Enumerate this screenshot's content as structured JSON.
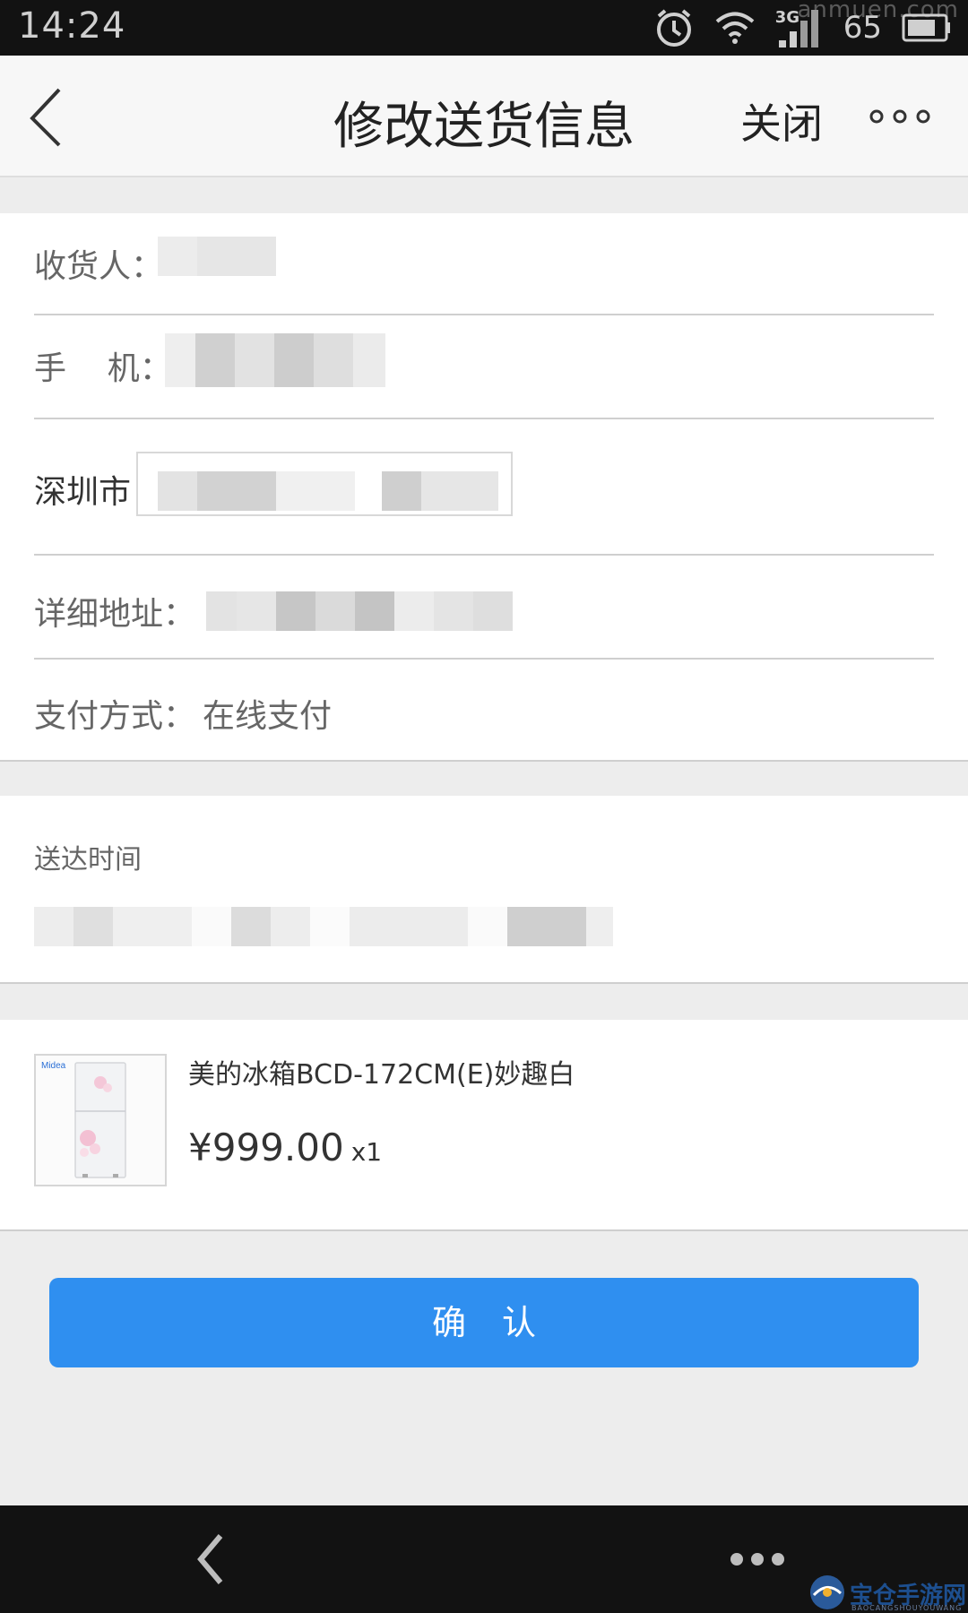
{
  "status_bar": {
    "time": "14:24",
    "network": "3G",
    "battery": "65",
    "watermark": "anmuen.com",
    "icons": [
      "alarm-icon",
      "wifi-icon",
      "signal-icon",
      "battery-icon"
    ]
  },
  "nav": {
    "title": "修改送货信息",
    "close_label": "关闭",
    "icons": [
      "back-icon",
      "more-icon"
    ]
  },
  "form": {
    "recipient_label": "收货人：",
    "phone_label": "手    机：",
    "city_label": "深圳市",
    "address_label": "详细地址：",
    "payment_label": "支付方式：",
    "payment_value": "在线支付"
  },
  "delivery": {
    "label": "送达时间"
  },
  "product": {
    "name": "美的冰箱BCD-172CM(E)妙趣白",
    "price": "¥999.00",
    "quantity": "x1",
    "brand": "Midea"
  },
  "confirm_label": "确认",
  "bottom_bar": {
    "icons": [
      "back-icon",
      "more-icon"
    ],
    "logo_text": "宝仓手游网",
    "logo_sub": "BAOCANGSHOUYOUWANG"
  },
  "colors": {
    "accent": "#2f8ff0",
    "background": "#ededed",
    "status_bar": "#121212"
  }
}
